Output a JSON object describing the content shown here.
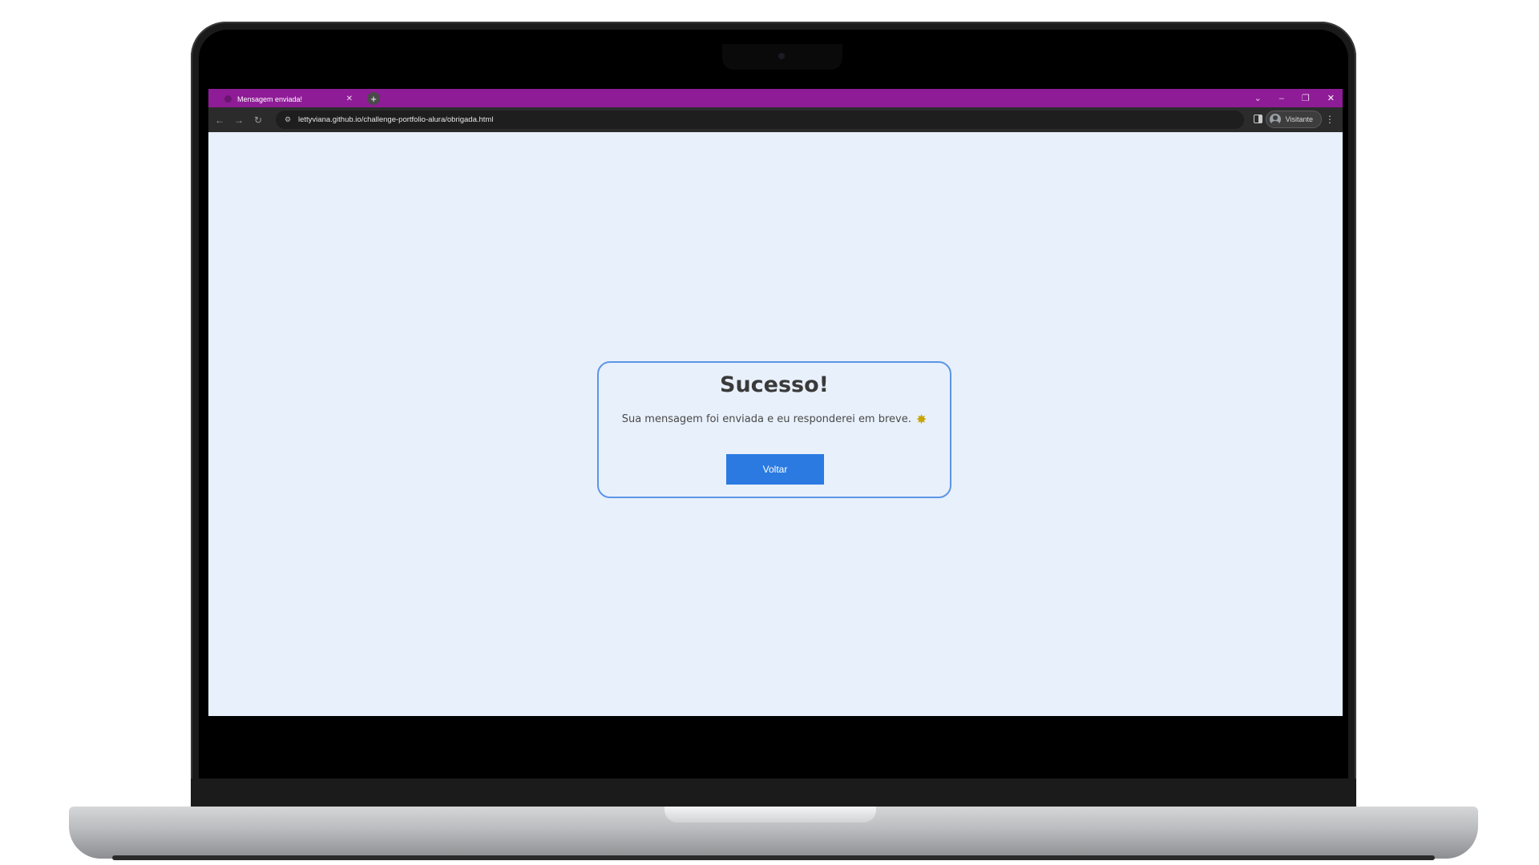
{
  "browser": {
    "tab_title": "Mensagem enviada!",
    "tab_close": "✕",
    "new_tab": "+",
    "url": "lettyviana.github.io/challenge-portfolio-alura/obrigada.html",
    "profile_label": "Visitante",
    "window_controls": {
      "dropdown": "⌄",
      "minimize": "–",
      "restore": "❐",
      "close": "✕"
    },
    "nav": {
      "back": "←",
      "forward": "→",
      "reload": "↻",
      "menu": "⋮",
      "site_info": "⚙"
    },
    "accent_color": "#8e1c96"
  },
  "page": {
    "title": "Sucesso!",
    "message": "Sua mensagem foi enviada e eu responderei em breve.",
    "message_icon": "✸",
    "button_label": "Voltar",
    "background_color": "#e8f0fb",
    "button_color": "#2a7ae2",
    "border_color": "#5c95e8"
  }
}
